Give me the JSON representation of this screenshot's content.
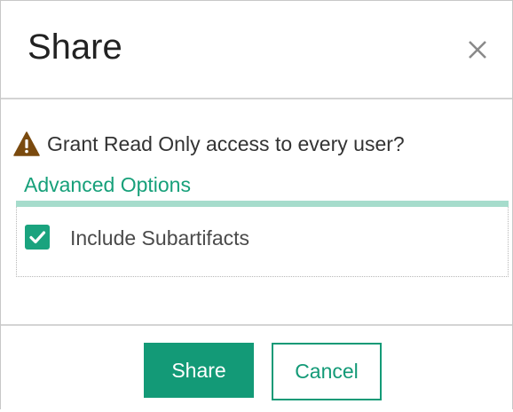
{
  "dialog": {
    "title": "Share",
    "close_icon": "close-icon"
  },
  "body": {
    "warning_icon": "warning-icon",
    "warning_text": "Grant Read Only access to every user?",
    "advanced_options_label": "Advanced Options",
    "include_subartifacts": {
      "label": "Include Subartifacts",
      "checked": true
    }
  },
  "footer": {
    "share_label": "Share",
    "cancel_label": "Cancel"
  },
  "colors": {
    "accent": "#139a77",
    "accent_light": "#a6dccc",
    "warning": "#7a4a0e"
  }
}
